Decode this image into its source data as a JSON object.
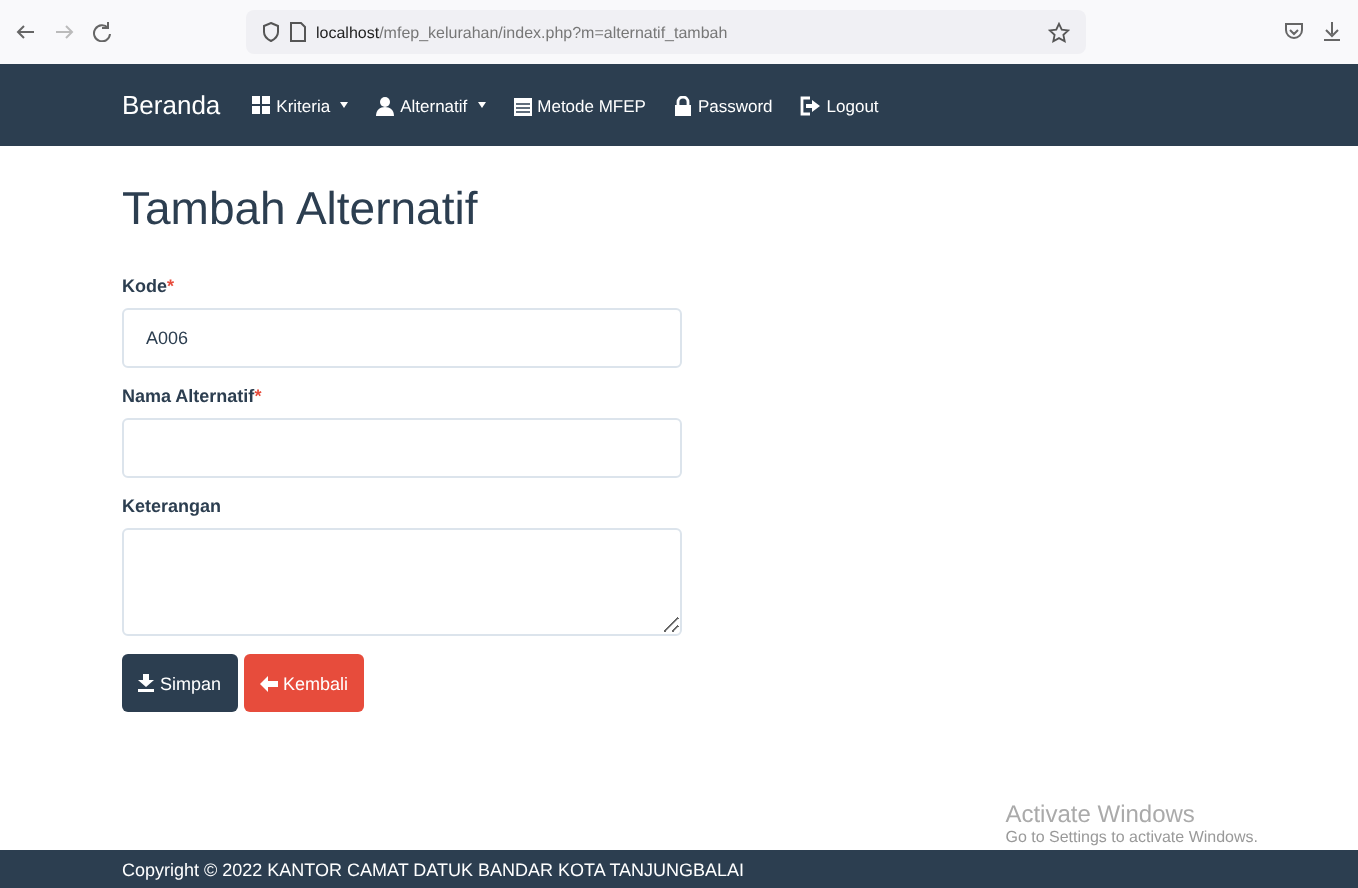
{
  "browser": {
    "url_host": "localhost",
    "url_path": "/mfep_kelurahan/index.php?m=alternatif_tambah"
  },
  "navbar": {
    "brand": "Beranda",
    "items": [
      {
        "label": "Kriteria",
        "dropdown": true
      },
      {
        "label": "Alternatif",
        "dropdown": true
      },
      {
        "label": "Metode MFEP",
        "dropdown": false
      },
      {
        "label": "Password",
        "dropdown": false
      },
      {
        "label": "Logout",
        "dropdown": false
      }
    ]
  },
  "page_title": "Tambah Alternatif",
  "form": {
    "fields": [
      {
        "kind": "input",
        "label": "Kode",
        "required": true,
        "value": "A006"
      },
      {
        "kind": "input",
        "label": "Nama Alternatif",
        "required": true
      },
      {
        "kind": "textarea",
        "label": "Keterangan",
        "required": false
      }
    ],
    "required_mark": "*",
    "buttons": [
      {
        "kind": "primary",
        "label": "Simpan"
      },
      {
        "kind": "danger",
        "label": "Kembali"
      }
    ]
  },
  "os_notice": {
    "title": "Activate Windows",
    "subtitle": "Go to Settings to activate Windows."
  },
  "footer": "Copyright © 2022 KANTOR CAMAT DATUK BANDAR KOTA TANJUNGBALAI"
}
